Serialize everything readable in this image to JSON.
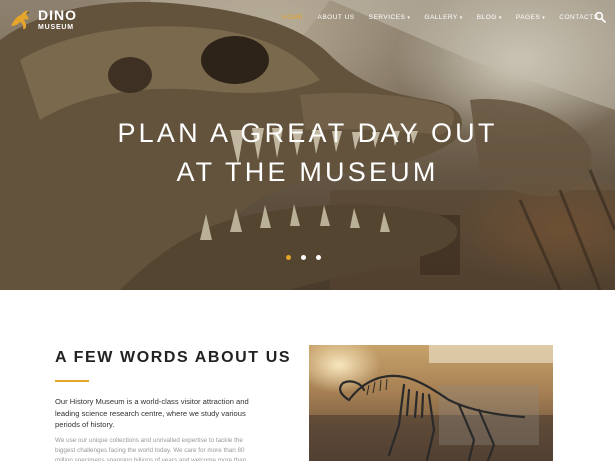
{
  "brand": {
    "name": "DINO",
    "tagline": "MUSEUM",
    "logo_icon": "kangaroo-dinosaur-logo",
    "accent": "#e5a52a"
  },
  "nav": {
    "items": [
      {
        "label": "HOME",
        "active": true,
        "dropdown": false
      },
      {
        "label": "ABOUT US",
        "active": false,
        "dropdown": false
      },
      {
        "label": "SERVICES",
        "active": false,
        "dropdown": true
      },
      {
        "label": "GALLERY",
        "active": false,
        "dropdown": true
      },
      {
        "label": "BLOG",
        "active": false,
        "dropdown": true
      },
      {
        "label": "PAGES",
        "active": false,
        "dropdown": true
      },
      {
        "label": "CONTACTS",
        "active": false,
        "dropdown": false
      }
    ],
    "search_icon": "search-icon"
  },
  "hero": {
    "line1": "PLAN A GREAT DAY OUT",
    "line2": "AT THE MUSEUM",
    "slides": 3,
    "active_slide": 1
  },
  "about": {
    "title": "A FEW WORDS ABOUT US",
    "lead": "Our History Museum is a world-class visitor attraction and leading science research centre, where we study various periods of history.",
    "body": "We use our unique collections and unrivalled expertise to tackle the biggest challenges facing the world today. We care for more than 80 million specimens spanning billions of years and welcome more than"
  }
}
